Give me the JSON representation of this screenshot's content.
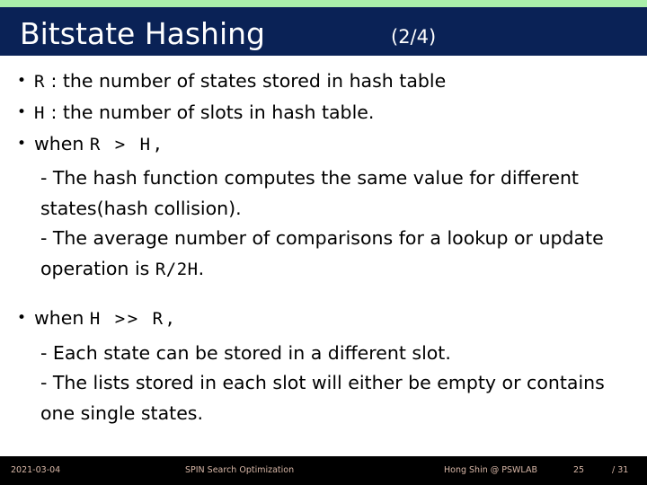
{
  "header": {
    "title": "Bitstate Hashing",
    "counter": "(2/4)",
    "accent_color": "#aaf0aa",
    "bar_color": "#0a2256",
    "title_color": "#ffffff"
  },
  "content": {
    "bullets": [
      {
        "marker": "•",
        "parts": [
          {
            "text": "R",
            "style": "mono"
          },
          {
            "text": " : the number of states stored in hash table",
            "style": "normal"
          }
        ]
      },
      {
        "marker": "•",
        "parts": [
          {
            "text": "H",
            "style": "mono"
          },
          {
            "text": " : the number of slots in hash table.",
            "style": "normal"
          }
        ]
      },
      {
        "marker": "•",
        "parts": [
          {
            "text": "when ",
            "style": "normal"
          },
          {
            "text": "R > H,",
            "style": "mono-sp"
          }
        ]
      }
    ],
    "group_one_subs": [
      {
        "lead": "- The hash function computes the same value for different states(hash collision).",
        "tail_mono": "",
        "tail": ""
      },
      {
        "lead": "- The average number of comparisons for a lookup or update operation is ",
        "tail_mono": "R/2H",
        "tail": "."
      }
    ],
    "bullet_two": {
      "marker": "•",
      "parts": [
        {
          "text": "when ",
          "style": "normal"
        },
        {
          "text": "H >> R,",
          "style": "mono-sp"
        }
      ]
    },
    "group_two_subs": [
      "- Each state can be stored in a different slot.",
      "- The lists stored in each slot will either be empty or contains one single states."
    ]
  },
  "footer": {
    "date": "2021-03-04",
    "center": "SPIN Search Optimization",
    "author": "Hong Shin @ PSWLAB",
    "page": "25",
    "total": "/ 31",
    "background": "#000000",
    "text_color": "#d9b8a8"
  }
}
